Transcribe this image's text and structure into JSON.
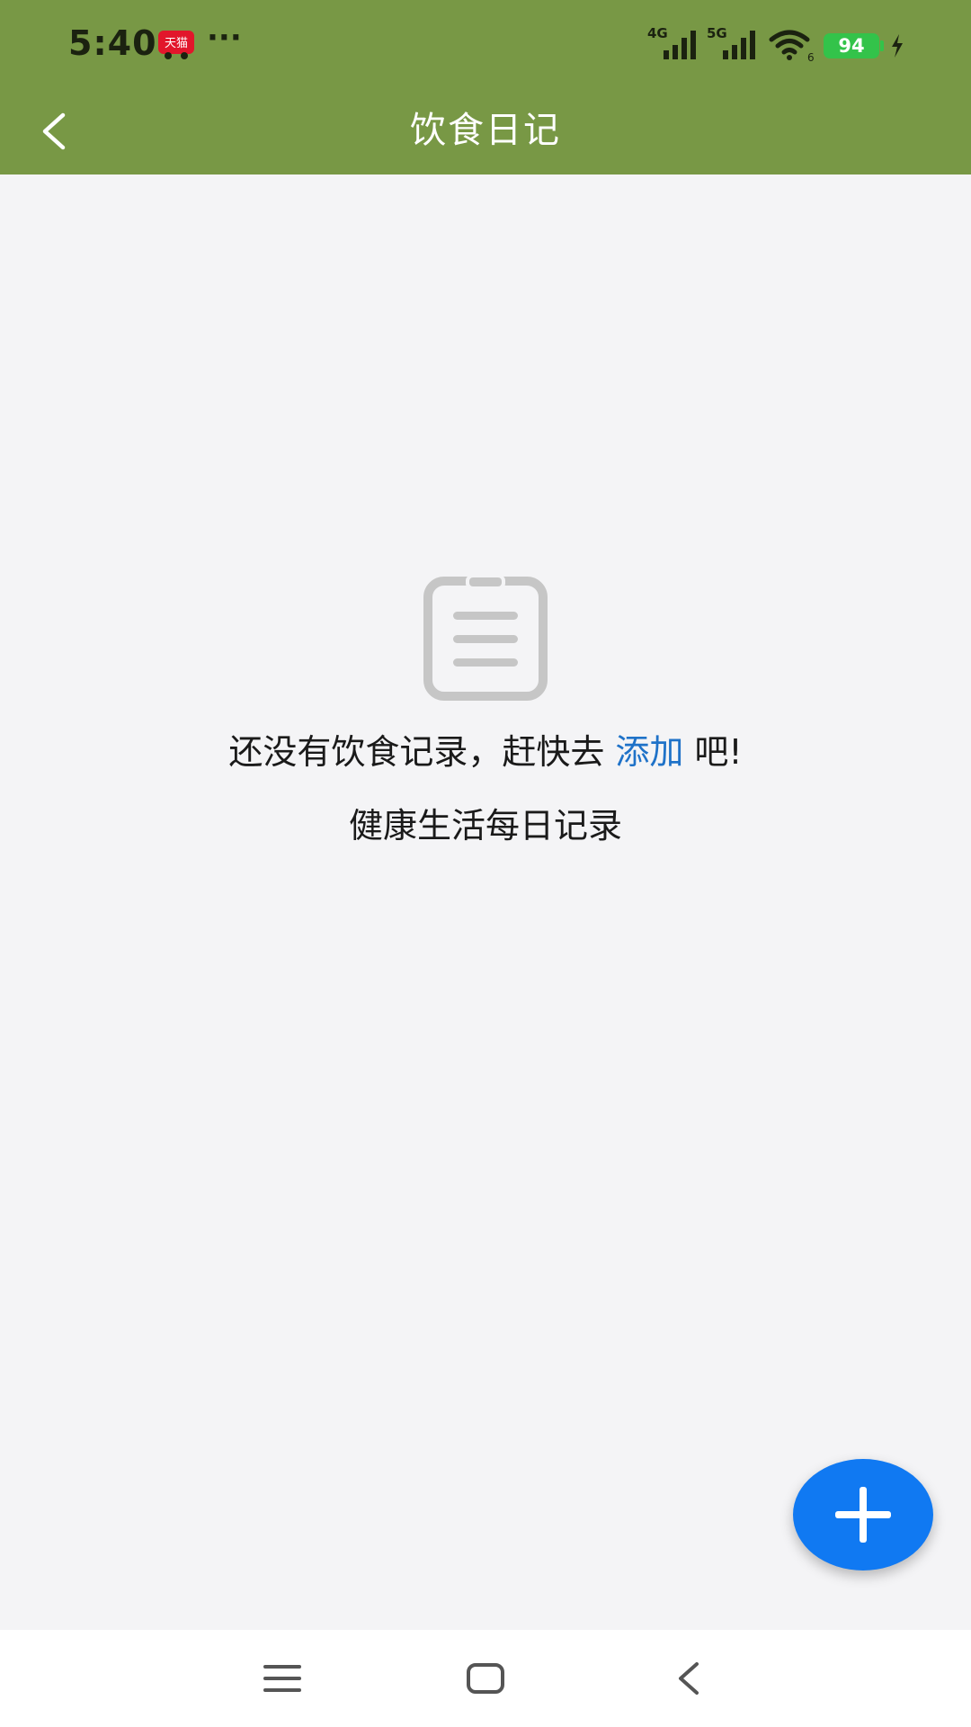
{
  "status_bar": {
    "time": "5:40",
    "app_badge": "天猫",
    "more": "···",
    "net1": "4G",
    "net2": "5G",
    "wifi_sub": "6",
    "battery": "94"
  },
  "header": {
    "title": "饮食日记",
    "background": "#789845"
  },
  "empty_state": {
    "message_before": "还没有饮食记录，赶快去",
    "link_text": "添加",
    "message_after": "吧!",
    "subtitle": "健康生活每日记录",
    "link_color": "#1f72c8"
  },
  "fab": {
    "icon": "plus-icon",
    "color": "#1079f2"
  },
  "system_nav": {
    "items": [
      "menu-icon",
      "home-icon",
      "back-icon"
    ]
  }
}
